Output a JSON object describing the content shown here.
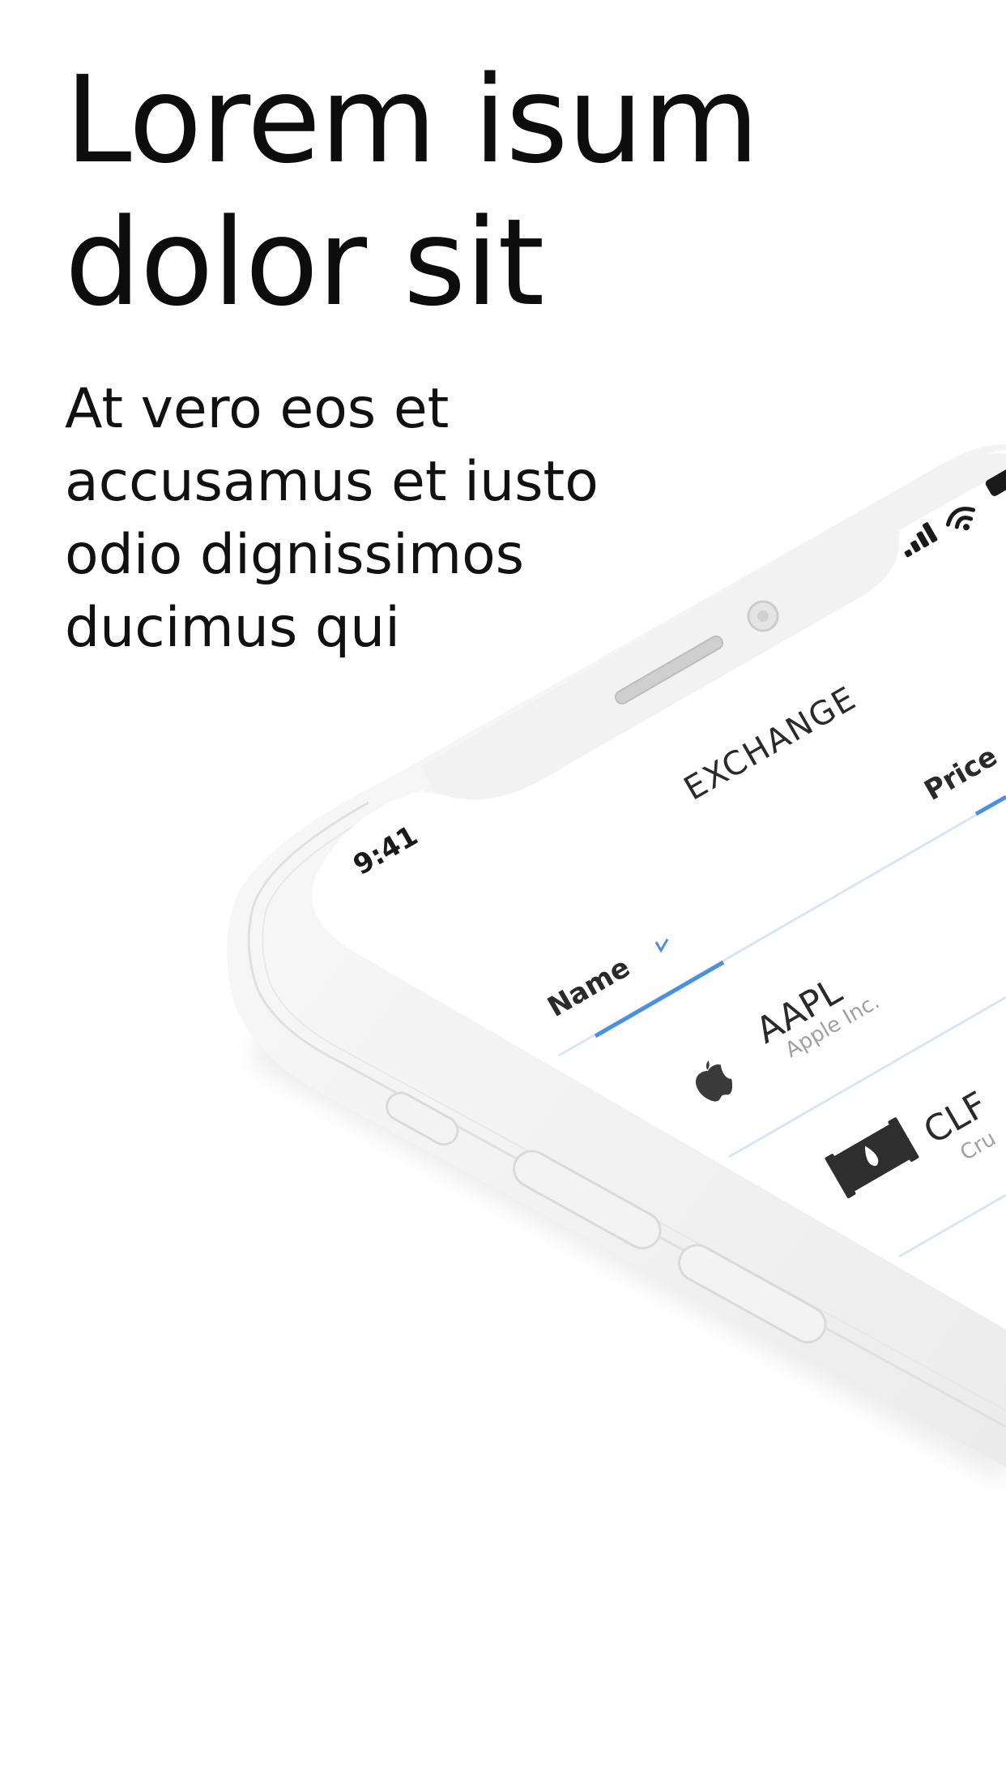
{
  "headline": {
    "line1": "Lorem isum",
    "line2": "dolor sit"
  },
  "subhead": {
    "line1": "At vero eos et",
    "line2": "accusamus et iusto",
    "line3": "odio dignissimos",
    "line4": "ducimus qui"
  },
  "phone": {
    "status_time": "9:41",
    "nav_title": "EXCHANGE",
    "columns": {
      "name": "Name",
      "price": "Price"
    },
    "rows": [
      {
        "symbol": "AAPL",
        "company": "Apple Inc.",
        "icon": "apple-icon"
      },
      {
        "symbol": "CLF",
        "company": "Cru",
        "icon": "oil-barrel-icon"
      }
    ]
  },
  "colors": {
    "accent": "#4a90e2",
    "divider": "#cfe0f5",
    "phone_body": "#f1f1f1",
    "text_primary": "#1a1a1a",
    "text_secondary": "#9a9a9a"
  }
}
